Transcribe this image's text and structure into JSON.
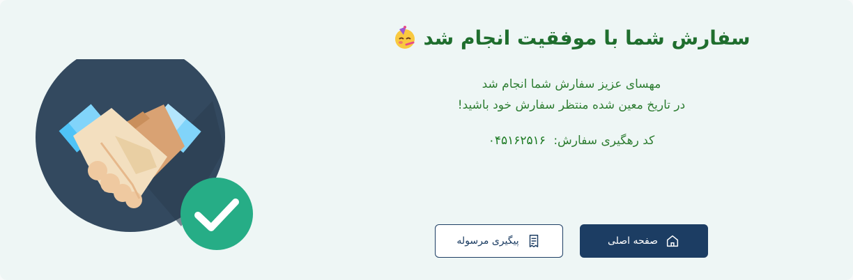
{
  "title": "سفارش شما با موفقیت انجام شد",
  "message": {
    "line1": "مهسای عزیز سفارش شما انجام شد",
    "line2": "در تاریخ معین شده منتظر سفارش خود باشید!"
  },
  "tracking": {
    "label": "کد رهگیری سفارش:",
    "code": "۰۴۵۱۶۲۵۱۶"
  },
  "buttons": {
    "home_label": "صفحه اصلی",
    "track_label": "پیگیری مرسوله"
  },
  "icons": {
    "illustration": "handshake-icon",
    "check": "check-badge-icon",
    "emoji": "party-face-emoji-icon",
    "home": "home-icon",
    "track": "receipt-icon"
  },
  "colors": {
    "background": "#eef6f5",
    "title": "#1f6e2e",
    "text": "#2e7d32",
    "primary": "#1c3d63",
    "check_badge": "#26ad86",
    "circle": "#33495f"
  }
}
